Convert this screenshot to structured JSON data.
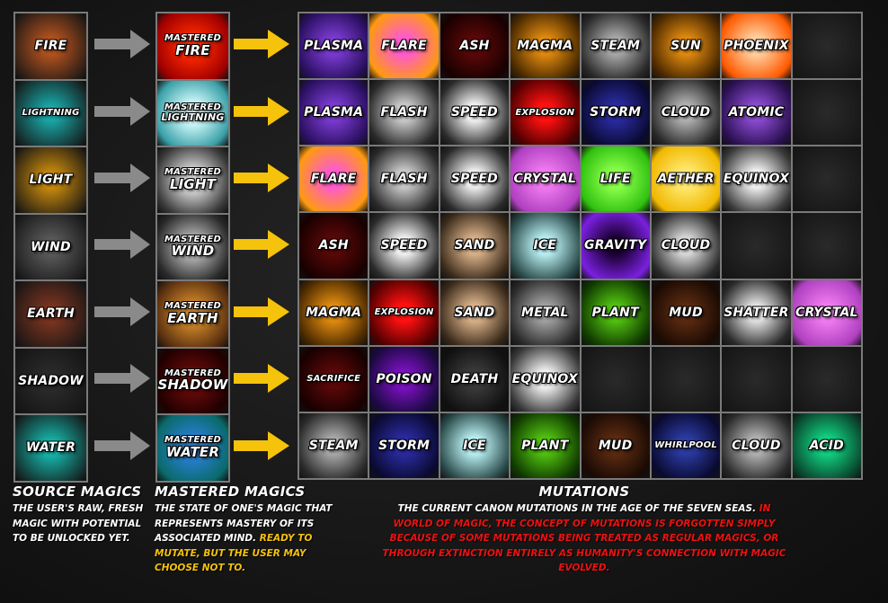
{
  "source": {
    "heading": "SOURCE MAGICS",
    "description": "THE USER'S RAW, FRESH MAGIC WITH POTENTIAL TO BE UNLOCKED YET.",
    "items": [
      {
        "label": "FIRE",
        "color": "#b5531f"
      },
      {
        "label": "LIGHTNING",
        "color": "#1aa6a6"
      },
      {
        "label": "LIGHT",
        "color": "#c98a0c"
      },
      {
        "label": "WIND",
        "color": "#5a5a5a"
      },
      {
        "label": "EARTH",
        "color": "#7a3420"
      },
      {
        "label": "SHADOW",
        "color": "#2b2b2b"
      },
      {
        "label": "WATER",
        "color": "#16b3a8"
      }
    ]
  },
  "mastered": {
    "heading": "MASTERED MAGICS",
    "description_white": "THE STATE OF ONE'S MAGIC THAT REPRESENTS MASTERY OF ITS ASSOCIATED MIND.",
    "description_yellow": "READY TO MUTATE, BUT THE USER MAY CHOOSE NOT TO.",
    "prefix": "MASTERED",
    "items": [
      {
        "label": "FIRE",
        "color": "#ff2a00",
        "edge": "#a00000"
      },
      {
        "label": "LIGHTNING",
        "color": "#d9ffff",
        "edge": "#3aa0a8"
      },
      {
        "label": "LIGHT",
        "color": "#e0e0e0",
        "edge": "#3a3a3a"
      },
      {
        "label": "WIND",
        "color": "#b8b8b8",
        "edge": "#2a2a2a"
      },
      {
        "label": "EARTH",
        "color": "#d48a2a",
        "edge": "#5a3010"
      },
      {
        "label": "SHADOW",
        "color": "#6a0a0a",
        "edge": "#200000"
      },
      {
        "label": "WATER",
        "color": "#2a7fd8",
        "edge": "#0a6a6a"
      }
    ]
  },
  "mutations": {
    "heading": "MUTATIONS",
    "description_white": "THE CURRENT CANON MUTATIONS IN THE AGE OF THE SEVEN SEAS.",
    "description_red": "IN WORLD OF MAGIC, THE CONCEPT OF MUTATIONS IS FORGOTTEN SIMPLY BECAUSE OF SOME MUTATIONS BEING TREATED AS REGULAR MAGICS, OR THROUGH EXTINCTION ENTIRELY AS HUMANITY'S CONNECTION WITH MAGIC EVOLVED.",
    "rows": [
      [
        {
          "label": "PLASMA",
          "color": "#7a3ad0",
          "edge": "#2a1060"
        },
        {
          "label": "FLARE",
          "color": "#ff5ad0",
          "edge": "#ff9a10"
        },
        {
          "label": "ASH",
          "color": "#5a0808",
          "edge": "#180000"
        },
        {
          "label": "MAGMA",
          "color": "#e08a10",
          "edge": "#4a2a00"
        },
        {
          "label": "STEAM",
          "color": "#a8a8a8",
          "edge": "#2a2a2a"
        },
        {
          "label": "SUN",
          "color": "#e08a10",
          "edge": "#4a2800"
        },
        {
          "label": "PHOENIX",
          "color": "#ffd0a0",
          "edge": "#ff5a00"
        },
        {
          "label": "",
          "color": "#2a2a2a",
          "edge": "#161616"
        }
      ],
      [
        {
          "label": "PLASMA",
          "color": "#7a3ad0",
          "edge": "#2a1060"
        },
        {
          "label": "FLASH",
          "color": "#c8c8c8",
          "edge": "#2a2a2a"
        },
        {
          "label": "SPEED",
          "color": "#f0f0f0",
          "edge": "#2a2a2a"
        },
        {
          "label": "EXPLOSION",
          "color": "#ff1010",
          "edge": "#500000"
        },
        {
          "label": "STORM",
          "color": "#2a2aa0",
          "edge": "#0a0a30"
        },
        {
          "label": "CLOUD",
          "color": "#b0b0b0",
          "edge": "#2a2a2a"
        },
        {
          "label": "ATOMIC",
          "color": "#8a4ad0",
          "edge": "#2a1050"
        },
        {
          "label": "",
          "color": "#2a2a2a",
          "edge": "#161616"
        }
      ],
      [
        {
          "label": "FLARE",
          "color": "#ff5ad0",
          "edge": "#ff9a10"
        },
        {
          "label": "FLASH",
          "color": "#c8c8c8",
          "edge": "#2a2a2a"
        },
        {
          "label": "SPEED",
          "color": "#f0f0f0",
          "edge": "#2a2a2a"
        },
        {
          "label": "CRYSTAL",
          "color": "#f07af0",
          "edge": "#b040c0"
        },
        {
          "label": "LIFE",
          "color": "#8aff4a",
          "edge": "#30c010"
        },
        {
          "label": "AETHER",
          "color": "#ffe870",
          "edge": "#f0b800"
        },
        {
          "label": "EQUINOX",
          "color": "#f0f0f0",
          "edge": "#3a3a3a"
        },
        {
          "label": "",
          "color": "#2a2a2a",
          "edge": "#161616"
        }
      ],
      [
        {
          "label": "ASH",
          "color": "#5a0808",
          "edge": "#180000"
        },
        {
          "label": "SPEED",
          "color": "#f0f0f0",
          "edge": "#2a2a2a"
        },
        {
          "label": "SAND",
          "color": "#d8b088",
          "edge": "#3a2a1a"
        },
        {
          "label": "ICE",
          "color": "#b8eef0",
          "edge": "#2a4a4a"
        },
        {
          "label": "GRAVITY",
          "color": "#1a0030",
          "edge": "#7a20e0"
        },
        {
          "label": "CLOUD",
          "color": "#d8d8d8",
          "edge": "#2a2a2a"
        },
        {
          "label": "",
          "color": "#2a2a2a",
          "edge": "#161616"
        },
        {
          "label": "",
          "color": "#2a2a2a",
          "edge": "#161616"
        }
      ],
      [
        {
          "label": "MAGMA",
          "color": "#e08a10",
          "edge": "#4a2a00"
        },
        {
          "label": "EXPLOSION",
          "color": "#ff1010",
          "edge": "#500000"
        },
        {
          "label": "SAND",
          "color": "#d8b088",
          "edge": "#3a2a1a"
        },
        {
          "label": "METAL",
          "color": "#a0a0a0",
          "edge": "#2a2a2a"
        },
        {
          "label": "PLANT",
          "color": "#50c010",
          "edge": "#103a00"
        },
        {
          "label": "MUD",
          "color": "#5a2a10",
          "edge": "#1a0a04"
        },
        {
          "label": "SHATTER",
          "color": "#e0e0e0",
          "edge": "#2a2a2a"
        },
        {
          "label": "CRYSTAL",
          "color": "#f07af0",
          "edge": "#b040c0"
        }
      ],
      [
        {
          "label": "SACRIFICE",
          "color": "#5a0808",
          "edge": "#180000"
        },
        {
          "label": "POISON",
          "color": "#7a10c0",
          "edge": "#1a0a40"
        },
        {
          "label": "DEATH",
          "color": "#3a3a3a",
          "edge": "#101010"
        },
        {
          "label": "EQUINOX",
          "color": "#f0f0f0",
          "edge": "#3a3a3a"
        },
        {
          "label": "",
          "color": "#2a2a2a",
          "edge": "#161616"
        },
        {
          "label": "",
          "color": "#2a2a2a",
          "edge": "#161616"
        },
        {
          "label": "",
          "color": "#2a2a2a",
          "edge": "#161616"
        },
        {
          "label": "",
          "color": "#2a2a2a",
          "edge": "#161616"
        }
      ],
      [
        {
          "label": "STEAM",
          "color": "#a8a8a8",
          "edge": "#2a2a2a"
        },
        {
          "label": "STORM",
          "color": "#2a2aa0",
          "edge": "#0a0a30"
        },
        {
          "label": "ICE",
          "color": "#b8eef0",
          "edge": "#2a4a4a"
        },
        {
          "label": "PLANT",
          "color": "#50c010",
          "edge": "#103a00"
        },
        {
          "label": "MUD",
          "color": "#5a2a10",
          "edge": "#1a0a04"
        },
        {
          "label": "WHIRLPOOL",
          "color": "#2a3aa0",
          "edge": "#0a0a30"
        },
        {
          "label": "CLOUD",
          "color": "#b0b0b0",
          "edge": "#2a2a2a"
        },
        {
          "label": "ACID",
          "color": "#10d080",
          "edge": "#0a4a30"
        }
      ]
    ]
  },
  "arrows": {
    "source_to_mastered": "arrow-right-gray",
    "mastered_to_mutations": "arrow-right-yellow"
  },
  "colors": {
    "gray_arrow": "#8a8a8a",
    "yellow_arrow": "#f5c20c",
    "grid_border": "#7a7a7a",
    "highlight_yellow": "#f5c20c",
    "highlight_red": "#ee1111"
  }
}
